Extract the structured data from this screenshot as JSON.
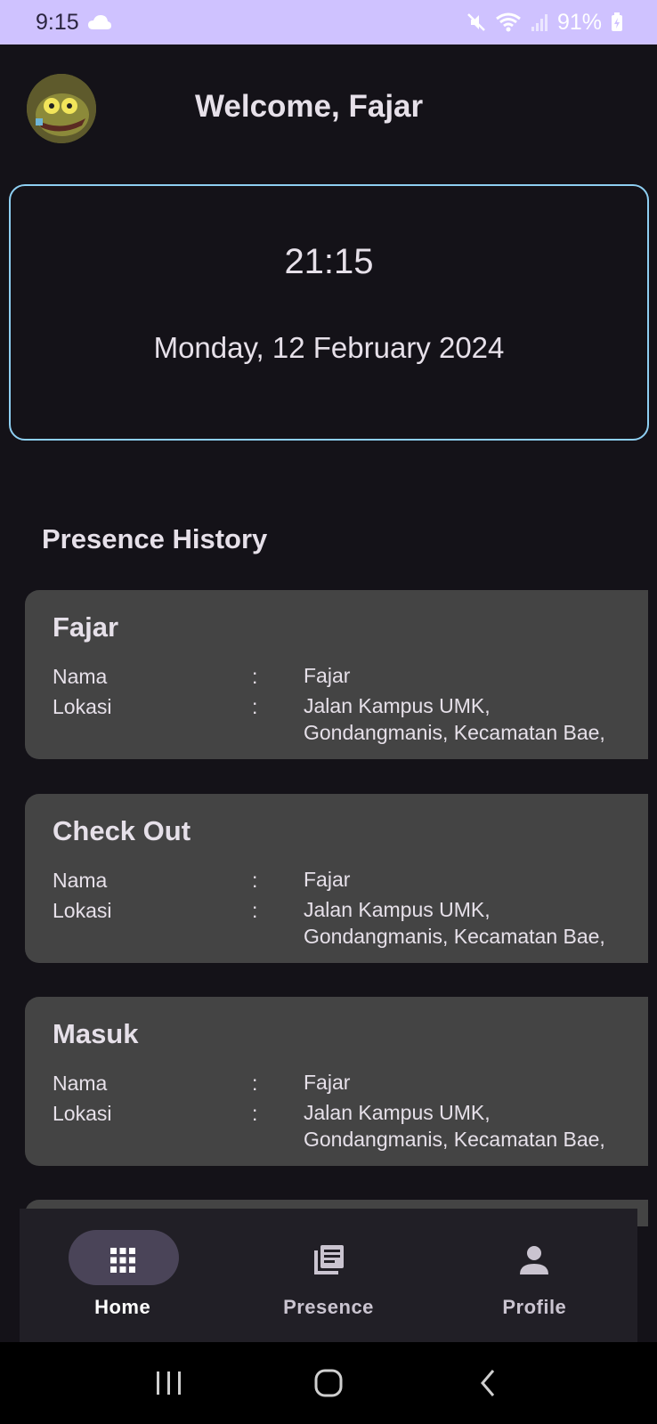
{
  "status_bar": {
    "time": "9:15",
    "battery": "91%",
    "icons": [
      "cloud-icon",
      "mute-icon",
      "wifi-icon",
      "signal-icon",
      "battery-charging-icon"
    ]
  },
  "header": {
    "welcome": "Welcome, Fajar"
  },
  "clock": {
    "time": "21:15",
    "date": "Monday, 12 February 2024"
  },
  "history": {
    "title": "Presence History",
    "records": [
      {
        "title": "Fajar",
        "name_label": "Nama",
        "colon": ":",
        "name_value": "Fajar",
        "location_label": "Lokasi",
        "location_value_1": "Jalan Kampus UMK,",
        "location_value_2": "Gondangmanis, Kecamatan Bae,"
      },
      {
        "title": "Check Out",
        "name_label": "Nama",
        "colon": ":",
        "name_value": "Fajar",
        "location_label": "Lokasi",
        "location_value_1": "Jalan Kampus UMK,",
        "location_value_2": "Gondangmanis, Kecamatan Bae,"
      },
      {
        "title": "Masuk",
        "name_label": "Nama",
        "colon": ":",
        "name_value": "Fajar",
        "location_label": "Lokasi",
        "location_value_1": "Jalan Kampus UMK,",
        "location_value_2": "Gondangmanis, Kecamatan Bae,"
      }
    ]
  },
  "bottom_nav": {
    "items": [
      {
        "label": "Home",
        "icon": "grid-icon",
        "active": true
      },
      {
        "label": "Presence",
        "icon": "list-icon",
        "active": false
      },
      {
        "label": "Profile",
        "icon": "person-icon",
        "active": false
      }
    ]
  },
  "colors": {
    "background": "#141218",
    "status_bar": "#cfc2ff",
    "card": "#444444",
    "clock_border": "#8ecff2",
    "nav_bg": "#211f26",
    "nav_pill": "#4a4458"
  }
}
